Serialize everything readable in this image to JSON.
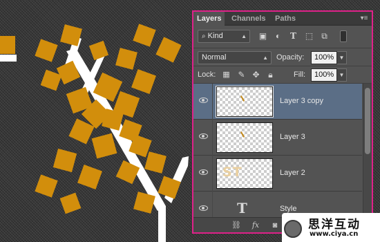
{
  "tabs": [
    {
      "label": "Layers",
      "active": true
    },
    {
      "label": "Channels",
      "active": false
    },
    {
      "label": "Paths",
      "active": false
    }
  ],
  "filter": {
    "kind_value": "Kind"
  },
  "blend": {
    "mode_value": "Normal",
    "opacity_label": "Opacity:",
    "opacity_value": "100%"
  },
  "lock": {
    "label": "Lock:",
    "fill_label": "Fill:",
    "fill_value": "100%"
  },
  "layers": [
    {
      "name": "Layer 3 copy",
      "selected": true,
      "thumb": "mark"
    },
    {
      "name": "Layer 3",
      "selected": false,
      "thumb": "mark"
    },
    {
      "name": "Layer 2",
      "selected": false,
      "thumb": "text",
      "thumb_text": "ST"
    },
    {
      "name": "Style",
      "selected": false,
      "thumb": "type"
    }
  ],
  "watermark": {
    "title": "思洋互动",
    "url": "www.ciya.cn"
  },
  "colors": {
    "accent_border": "#e0218a",
    "panel_bg": "#535353",
    "selected_row": "#5b6e86",
    "gold_tile": "#d28e0c",
    "canvas_bg": "#3b3b3b"
  }
}
